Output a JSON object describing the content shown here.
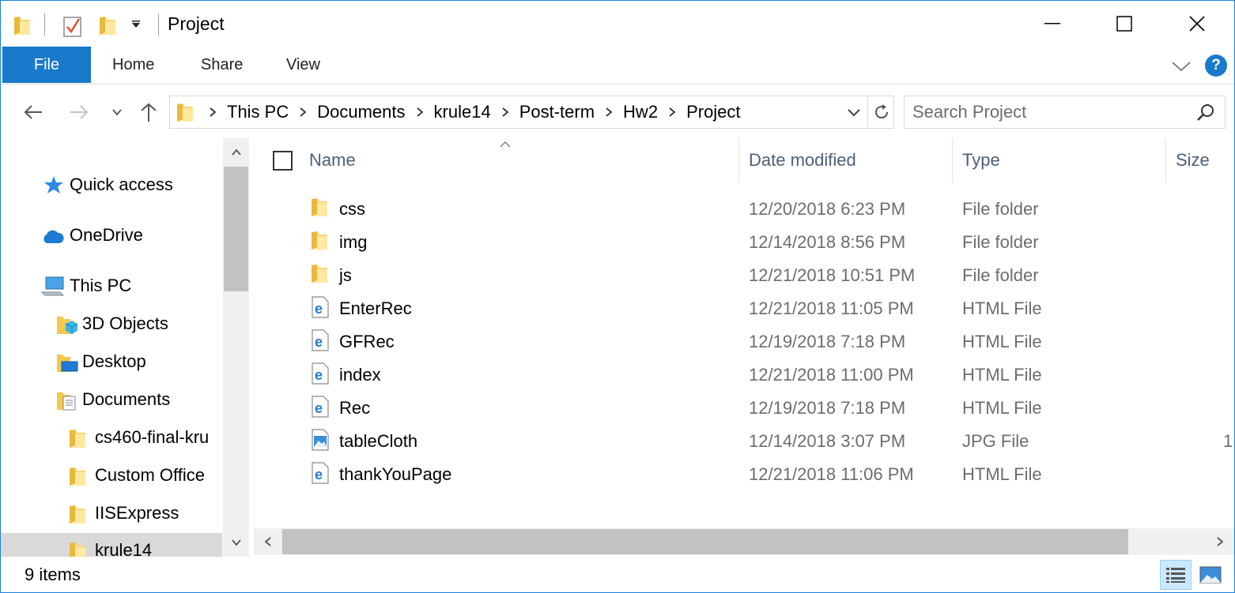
{
  "window": {
    "title": "Project",
    "accent_color": "#1979ca"
  },
  "title_bar": {
    "quick_access_icons": [
      "folder-icon",
      "properties-checkmark-icon",
      "new-folder-icon",
      "customize-dropdown-icon"
    ],
    "controls": [
      "minimize-icon",
      "maximize-icon",
      "close-icon"
    ]
  },
  "ribbon": {
    "tabs": [
      {
        "label": "File",
        "active": true
      },
      {
        "label": "Home"
      },
      {
        "label": "Share"
      },
      {
        "label": "View"
      }
    ],
    "help_label": "?"
  },
  "navigation": {
    "breadcrumbs": [
      "This PC",
      "Documents",
      "krule14",
      "Post-term",
      "Hw2",
      "Project"
    ],
    "search_placeholder": "Search Project"
  },
  "nav_pane": {
    "items": [
      {
        "label": "Quick access",
        "icon": "star-icon"
      },
      {
        "label": "OneDrive",
        "icon": "cloud-icon"
      },
      {
        "label": "This PC",
        "icon": "computer-icon"
      },
      {
        "label": "3D Objects",
        "icon": "3d-objects-icon"
      },
      {
        "label": "Desktop",
        "icon": "desktop-icon"
      },
      {
        "label": "Documents",
        "icon": "documents-icon"
      },
      {
        "label": "cs460-final-kru",
        "icon": "folder-icon"
      },
      {
        "label": "Custom Office ",
        "icon": "folder-icon"
      },
      {
        "label": "IISExpress",
        "icon": "folder-icon"
      },
      {
        "label": "krule14",
        "icon": "folder-icon",
        "selected": true
      }
    ]
  },
  "file_list": {
    "columns": {
      "name": "Name",
      "date": "Date modified",
      "type": "Type",
      "size": "Size"
    },
    "files": [
      {
        "name": "css",
        "date": "12/20/2018 6:23 PM",
        "type": "File folder",
        "size": "",
        "icon": "folder-icon"
      },
      {
        "name": "img",
        "date": "12/14/2018 8:56 PM",
        "type": "File folder",
        "size": "",
        "icon": "folder-icon"
      },
      {
        "name": "js",
        "date": "12/21/2018 10:51 PM",
        "type": "File folder",
        "size": "",
        "icon": "folder-icon"
      },
      {
        "name": "EnterRec",
        "date": "12/21/2018 11:05 PM",
        "type": "HTML File",
        "size": "",
        "icon": "edge-html-icon"
      },
      {
        "name": "GFRec",
        "date": "12/19/2018 7:18 PM",
        "type": "HTML File",
        "size": "",
        "icon": "edge-html-icon"
      },
      {
        "name": "index",
        "date": "12/21/2018 11:00 PM",
        "type": "HTML File",
        "size": "",
        "icon": "edge-html-icon"
      },
      {
        "name": "Rec",
        "date": "12/19/2018 7:18 PM",
        "type": "HTML File",
        "size": "",
        "icon": "edge-html-icon"
      },
      {
        "name": "tableCloth",
        "date": "12/14/2018 3:07 PM",
        "type": "JPG File",
        "size": "1",
        "icon": "image-file-icon"
      },
      {
        "name": "thankYouPage",
        "date": "12/21/2018 11:06 PM",
        "type": "HTML File",
        "size": "",
        "icon": "edge-html-icon"
      }
    ]
  },
  "status_bar": {
    "item_count": "9 items",
    "view_modes": [
      "details-view-icon",
      "large-icons-view-icon"
    ]
  }
}
